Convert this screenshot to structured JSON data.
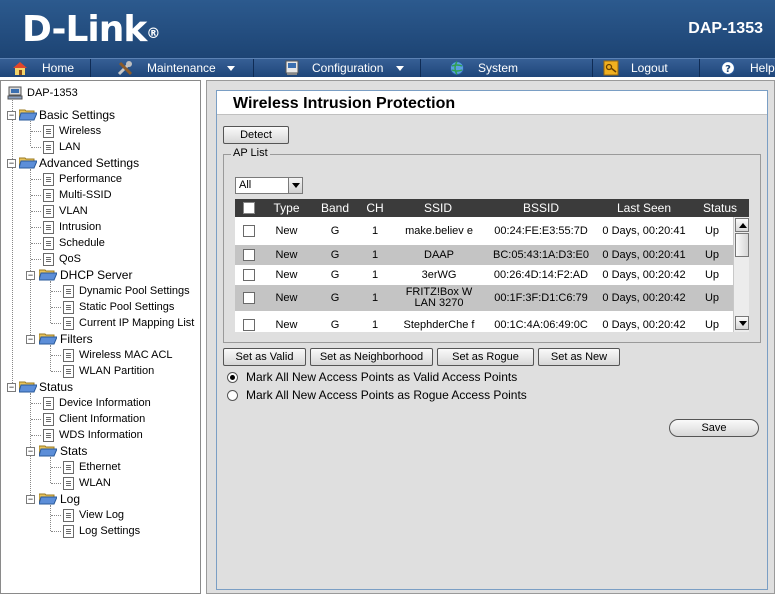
{
  "header": {
    "brand": "D-Link",
    "brand_mark": "®",
    "model": "DAP-1353"
  },
  "menu": [
    {
      "label": "Home",
      "icon": "home-icon"
    },
    {
      "label": "Maintenance",
      "icon": "tools-icon",
      "dropdown": true
    },
    {
      "label": "Configuration",
      "icon": "computer-icon",
      "dropdown": true
    },
    {
      "label": "System",
      "icon": "globe-icon"
    },
    {
      "label": "Logout",
      "icon": "key-icon"
    },
    {
      "label": "Help",
      "icon": "help-icon"
    }
  ],
  "tree": {
    "root": "DAP-1353",
    "basic": {
      "label": "Basic Settings",
      "items": [
        "Wireless",
        "LAN"
      ]
    },
    "advanced": {
      "label": "Advanced Settings",
      "items": [
        "Performance",
        "Multi-SSID",
        "VLAN",
        "Intrusion",
        "Schedule",
        "QoS"
      ],
      "dhcp": {
        "label": "DHCP Server",
        "items": [
          "Dynamic Pool Settings",
          "Static Pool Settings",
          "Current IP Mapping List"
        ]
      },
      "filters": {
        "label": "Filters",
        "items": [
          "Wireless MAC ACL",
          "WLAN Partition"
        ]
      }
    },
    "status": {
      "label": "Status",
      "items": [
        "Device Information",
        "Client Information",
        "WDS Information"
      ],
      "stats": {
        "label": "Stats",
        "items": [
          "Ethernet",
          "WLAN"
        ]
      },
      "log": {
        "label": "Log",
        "items": [
          "View Log",
          "Log Settings"
        ]
      }
    }
  },
  "main": {
    "title": "Wireless Intrusion Protection",
    "detect_label": "Detect",
    "ap_list_legend": "AP List",
    "filter_value": "All",
    "table": {
      "headers": [
        "Type",
        "Band",
        "CH",
        "SSID",
        "BSSID",
        "Last Seen",
        "Status"
      ],
      "rows": [
        {
          "type": "New",
          "band": "G",
          "ch": "1",
          "ssid": "make.believ e",
          "bssid": "00:24:FE:E3:55:7D",
          "last_seen": "0 Days, 00:20:41",
          "status": "Up"
        },
        {
          "type": "New",
          "band": "G",
          "ch": "1",
          "ssid": "DAAP",
          "bssid": "BC:05:43:1A:D3:E0",
          "last_seen": "0 Days, 00:20:41",
          "status": "Up"
        },
        {
          "type": "New",
          "band": "G",
          "ch": "1",
          "ssid": "3erWG",
          "bssid": "00:26:4D:14:F2:AD",
          "last_seen": "0 Days, 00:20:42",
          "status": "Up"
        },
        {
          "type": "New",
          "band": "G",
          "ch": "1",
          "ssid": "FRITZ!Box W LAN 3270",
          "bssid": "00:1F:3F:D1:C6:79",
          "last_seen": "0 Days, 00:20:42",
          "status": "Up"
        },
        {
          "type": "New",
          "band": "G",
          "ch": "1",
          "ssid": "StephderChe f",
          "bssid": "00:1C:4A:06:49:0C",
          "last_seen": "0 Days, 00:20:42",
          "status": "Up"
        }
      ]
    },
    "actions": [
      "Set as Valid",
      "Set as Neighborhood",
      "Set as Rogue",
      "Set as New"
    ],
    "radio_valid": "Mark All New Access Points as Valid Access Points",
    "radio_rogue": "Mark All New Access Points as Rogue Access Points",
    "save_label": "Save"
  }
}
